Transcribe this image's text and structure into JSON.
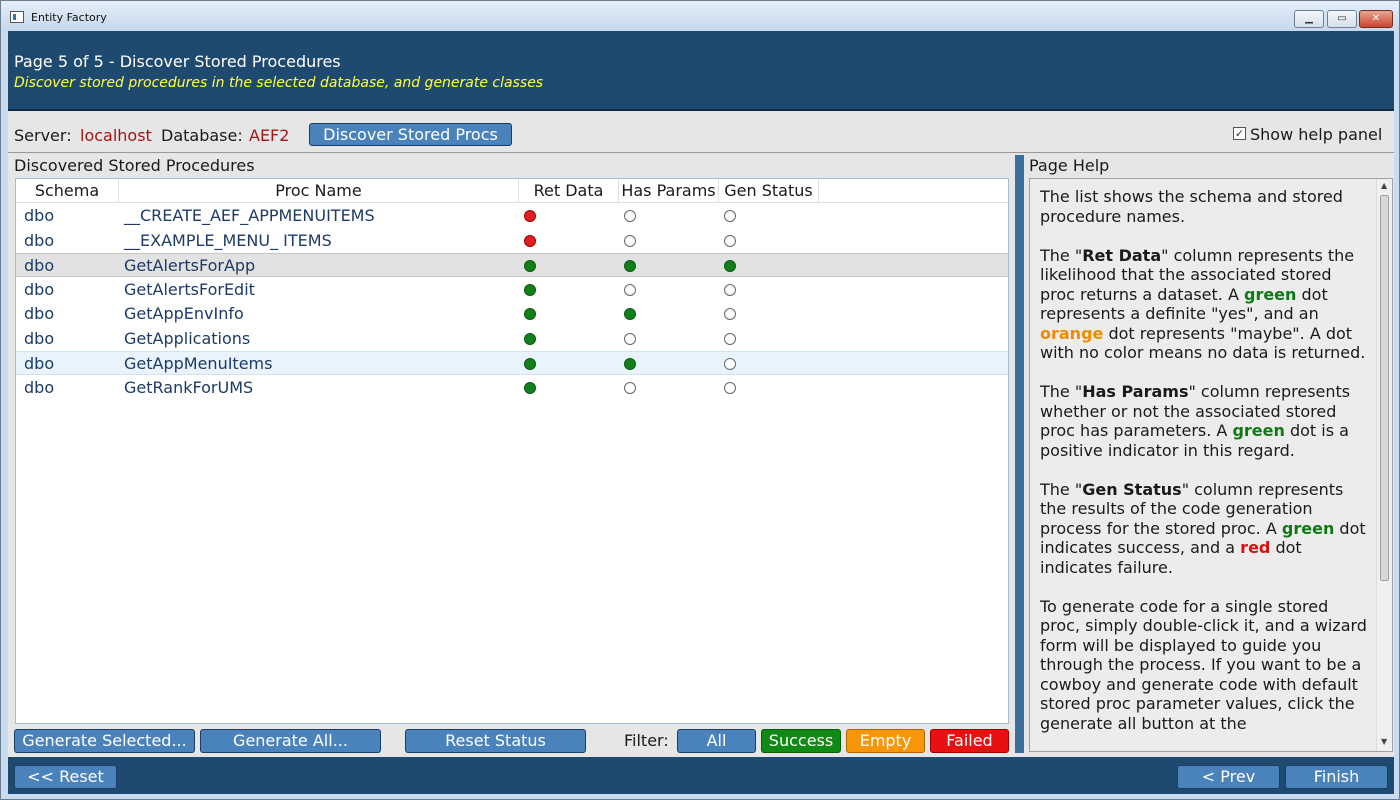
{
  "window": {
    "title": "Entity Factory",
    "controls": {
      "minimize": "▁",
      "maximize": "▭",
      "close": "✕"
    }
  },
  "header": {
    "title": "Page 5 of 5 - Discover Stored Procedures",
    "subtitle": "Discover stored procedures in the selected database, and generate classes"
  },
  "toolbar": {
    "server_label": "Server:",
    "server_value": "localhost",
    "database_label": "Database:",
    "database_value": "AEF2",
    "discover_button": "Discover Stored Procs",
    "show_help_checked": true,
    "show_help_label": "Show help panel"
  },
  "grid": {
    "title": "Discovered Stored Procedures",
    "columns": [
      "Schema",
      "Proc Name",
      "Ret Data",
      "Has Params",
      "Gen Status"
    ],
    "rows": [
      {
        "schema": "dbo",
        "proc": "__CREATE_AEF_APPMENUITEMS",
        "ret": "red",
        "params": "none",
        "gen": "none"
      },
      {
        "schema": "dbo",
        "proc": "__EXAMPLE_MENU_ ITEMS",
        "ret": "red",
        "params": "none",
        "gen": "none"
      },
      {
        "schema": "dbo",
        "proc": "GetAlertsForApp",
        "ret": "green",
        "params": "green",
        "gen": "green"
      },
      {
        "schema": "dbo",
        "proc": "GetAlertsForEdit",
        "ret": "green",
        "params": "none",
        "gen": "none"
      },
      {
        "schema": "dbo",
        "proc": "GetAppEnvInfo",
        "ret": "green",
        "params": "green",
        "gen": "none"
      },
      {
        "schema": "dbo",
        "proc": "GetApplications",
        "ret": "green",
        "params": "none",
        "gen": "none"
      },
      {
        "schema": "dbo",
        "proc": "GetAppMenuItems",
        "ret": "green",
        "params": "green",
        "gen": "none"
      },
      {
        "schema": "dbo",
        "proc": "GetRankForUMS",
        "ret": "green",
        "params": "none",
        "gen": "none"
      }
    ],
    "selected_row": 2,
    "hover_row": 6
  },
  "actions": {
    "generate_selected": "Generate Selected...",
    "generate_all": "Generate All...",
    "reset_status": "Reset Status",
    "filter_label": "Filter:",
    "filter_all": "All",
    "filter_success": "Success",
    "filter_empty": "Empty",
    "filter_failed": "Failed"
  },
  "colors": {
    "filter_all": "#4a82bb",
    "filter_success": "#0f8a14",
    "filter_empty": "#f8960a",
    "filter_failed": "#e81010"
  },
  "help": {
    "title": "Page Help",
    "p1": "The list shows the schema and stored procedure names.",
    "p2_a": "The \"",
    "p2_b": "Ret Data",
    "p2_c": "\" column represents the likelihood that the associated stored proc returns a dataset. A ",
    "p2_d": "green",
    "p2_e": " dot represents a definite \"yes\", and an ",
    "p2_f": "orange",
    "p2_g": " dot represents \"maybe\". A dot with no color means no data is returned.",
    "p3_a": "The \"",
    "p3_b": "Has Params",
    "p3_c": "\" column represents whether or not the associated stored proc has parameters. A ",
    "p3_d": "green",
    "p3_e": " dot is a positive indicator in this regard.",
    "p4_a": "The \"",
    "p4_b": "Gen Status",
    "p4_c": "\" column represents the results of the code generation process for the stored proc. A ",
    "p4_d": "green",
    "p4_e": " dot indicates success, and a ",
    "p4_f": "red",
    "p4_g": " dot indicates failure.",
    "p5": "To generate code for a single stored proc, simply double-click it, and a wizard form will be displayed to guide you through the process. If you want to be a cowboy and generate code with default stored proc parameter values, click the generate all button at the"
  },
  "footer": {
    "reset": "<< Reset",
    "prev": "< Prev",
    "finish": "Finish"
  }
}
